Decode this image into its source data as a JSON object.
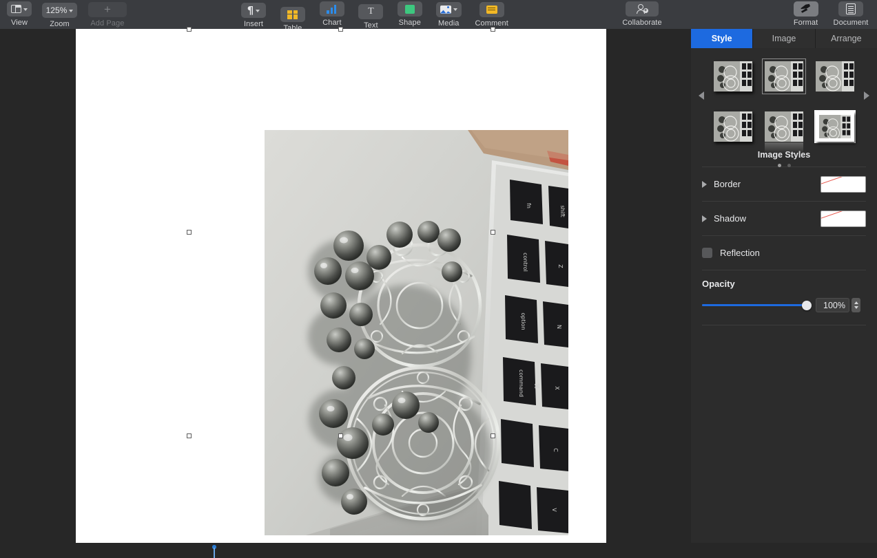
{
  "toolbar": {
    "left_items": [
      {
        "label": "View",
        "icon": "view-layout-icon",
        "has_chevron": true,
        "disabled": false
      },
      {
        "label": "Zoom",
        "icon": "zoom-level-text",
        "value": "125%",
        "has_chevron": true,
        "disabled": false
      },
      {
        "label": "Add Page",
        "icon": "plus-icon",
        "has_chevron": false,
        "disabled": true
      }
    ],
    "center_items": [
      {
        "label": "Insert",
        "icon": "pilcrow-icon",
        "has_chevron": true
      },
      {
        "label": "Table",
        "icon": "table-icon",
        "has_chevron": false
      },
      {
        "label": "Chart",
        "icon": "bar-chart-icon",
        "has_chevron": false
      },
      {
        "label": "Text",
        "icon": "text-t-icon",
        "has_chevron": false
      },
      {
        "label": "Shape",
        "icon": "shape-square-icon",
        "has_chevron": false
      },
      {
        "label": "Media",
        "icon": "media-photo-icon",
        "has_chevron": true
      },
      {
        "label": "Comment",
        "icon": "comment-icon",
        "has_chevron": false
      }
    ],
    "collaborate": {
      "label": "Collaborate",
      "icon": "collaborate-person-add-icon"
    },
    "right_items": [
      {
        "label": "Format",
        "icon": "format-paintbrush-icon",
        "active": true
      },
      {
        "label": "Document",
        "icon": "document-lines-icon",
        "active": false
      }
    ]
  },
  "sidebar": {
    "tabs": [
      {
        "label": "Style",
        "active": true
      },
      {
        "label": "Image",
        "active": false
      },
      {
        "label": "Arrange",
        "active": false
      }
    ],
    "image_styles": {
      "caption": "Image Styles",
      "prev_arrow": "left-triangle-icon",
      "next_arrow": "right-triangle-icon",
      "thumbnails": [
        {
          "name": "style-1-plain-shadow",
          "selected": false
        },
        {
          "name": "style-2-thin-outline",
          "selected": false
        },
        {
          "name": "style-3-plain",
          "selected": false
        },
        {
          "name": "style-4-shadow",
          "selected": false
        },
        {
          "name": "style-5-reflection",
          "selected": false
        },
        {
          "name": "style-6-white-frame",
          "selected": true
        }
      ],
      "page_dots": [
        {
          "active": true
        },
        {
          "active": false
        }
      ]
    },
    "border": {
      "label": "Border",
      "value": "None"
    },
    "shadow": {
      "label": "Shadow",
      "value": "None"
    },
    "reflection": {
      "label": "Reflection",
      "checked": false
    },
    "opacity": {
      "label": "Opacity",
      "value": "100%",
      "percent": 100
    }
  },
  "canvas": {
    "selected_object": "image-object",
    "image_description": "Silver filigree jewelry with bell charms resting on a laptop keyboard",
    "text_cursor": "text-insertion-marker"
  },
  "colors": {
    "accent": "#1d6ae0",
    "toolbar_bg": "#3a3c40",
    "sidebar_bg": "#2c2c2c",
    "canvas_bg": "#272727",
    "page_bg": "#ffffff",
    "swatch_none_stroke": "#e8554a"
  }
}
